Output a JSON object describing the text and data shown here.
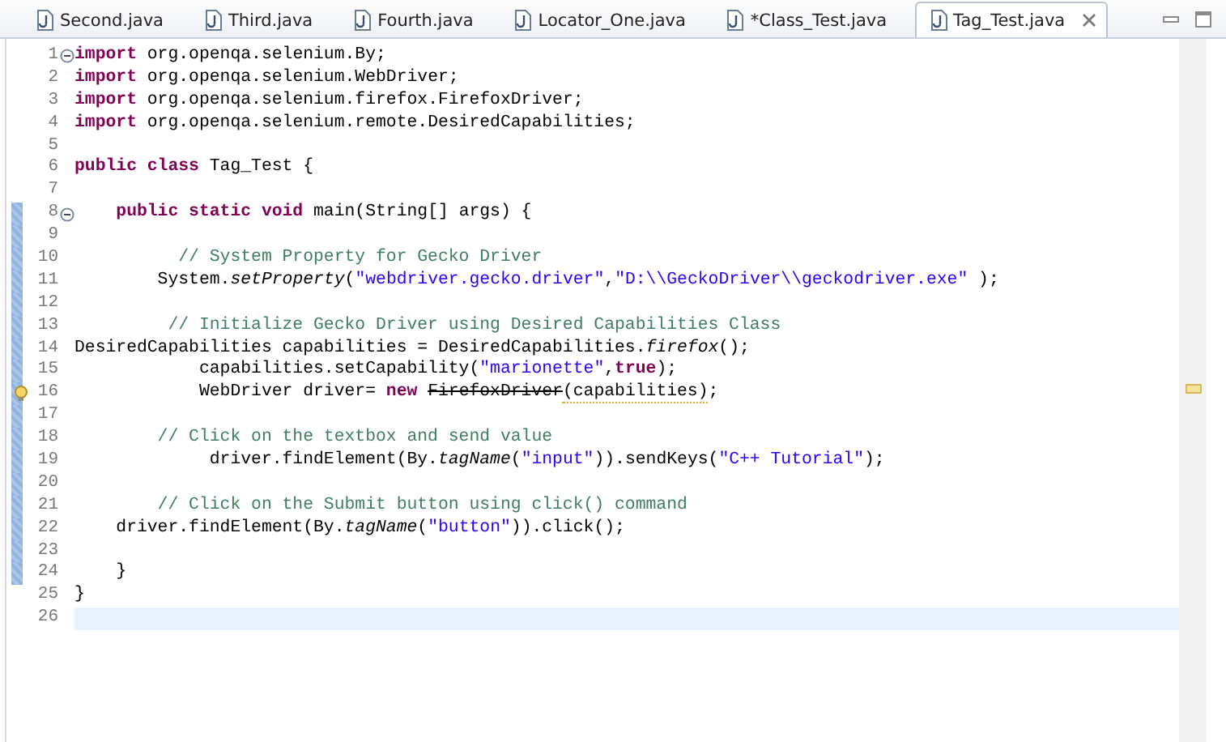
{
  "tabs": [
    {
      "label": "Second.java",
      "selected": false
    },
    {
      "label": "Third.java",
      "selected": false
    },
    {
      "label": "Fourth.java",
      "selected": false
    },
    {
      "label": "Locator_One.java",
      "selected": false
    },
    {
      "label": "*Class_Test.java",
      "selected": false
    },
    {
      "label": "Tag_Test.java",
      "selected": true
    }
  ],
  "editor": {
    "lines": [
      {
        "number": "1",
        "fold": true,
        "changed": false,
        "warning": false,
        "current": false,
        "tokens": [
          {
            "t": "import",
            "kind": "kw"
          },
          {
            "t": " org.openqa.selenium.By;",
            "kind": "plain"
          }
        ]
      },
      {
        "number": "2",
        "fold": false,
        "changed": false,
        "warning": false,
        "current": false,
        "tokens": [
          {
            "t": "import",
            "kind": "kw"
          },
          {
            "t": " org.openqa.selenium.WebDriver;",
            "kind": "plain"
          }
        ]
      },
      {
        "number": "3",
        "fold": false,
        "changed": false,
        "warning": false,
        "current": false,
        "tokens": [
          {
            "t": "import",
            "kind": "kw"
          },
          {
            "t": " org.openqa.selenium.firefox.FirefoxDriver;",
            "kind": "plain"
          }
        ]
      },
      {
        "number": "4",
        "fold": false,
        "changed": false,
        "warning": false,
        "current": false,
        "tokens": [
          {
            "t": "import",
            "kind": "kw"
          },
          {
            "t": " org.openqa.selenium.remote.DesiredCapabilities;",
            "kind": "plain"
          }
        ]
      },
      {
        "number": "5",
        "fold": false,
        "changed": false,
        "warning": false,
        "current": false
      },
      {
        "number": "6",
        "fold": false,
        "changed": false,
        "warning": false,
        "current": false,
        "tokens": [
          {
            "t": "public class",
            "kind": "kw"
          },
          {
            "t": " Tag_Test {",
            "kind": "plain"
          }
        ]
      },
      {
        "number": "7",
        "fold": false,
        "changed": false,
        "warning": false,
        "current": false
      },
      {
        "number": "8",
        "fold": true,
        "changed": true,
        "warning": false,
        "current": false,
        "tokens": [
          {
            "t": "    public static void",
            "kind": "kw"
          },
          {
            "t": " main(String[] args) {",
            "kind": "plain"
          }
        ]
      },
      {
        "number": "9",
        "fold": false,
        "changed": true,
        "warning": false,
        "current": false
      },
      {
        "number": "10",
        "fold": false,
        "changed": true,
        "warning": false,
        "current": false,
        "tokens": [
          {
            "t": "          // System Property for Gecko Driver",
            "kind": "comment"
          }
        ]
      },
      {
        "number": "11",
        "fold": false,
        "changed": true,
        "warning": false,
        "current": false,
        "tokens": [
          {
            "t": "        System.",
            "kind": "plain"
          },
          {
            "t": "setProperty",
            "kind": "italic"
          },
          {
            "t": "(",
            "kind": "plain"
          },
          {
            "t": "\"webdriver.gecko.driver\"",
            "kind": "str"
          },
          {
            "t": ",",
            "kind": "plain"
          },
          {
            "t": "\"D:\\\\GeckoDriver\\\\geckodriver.exe\"",
            "kind": "str"
          },
          {
            "t": " );",
            "kind": "plain"
          }
        ]
      },
      {
        "number": "12",
        "fold": false,
        "changed": true,
        "warning": false,
        "current": false
      },
      {
        "number": "13",
        "fold": false,
        "changed": true,
        "warning": false,
        "current": false,
        "tokens": [
          {
            "t": "         // Initialize Gecko Driver using Desired Capabilities Class",
            "kind": "comment"
          }
        ]
      },
      {
        "number": "14",
        "fold": false,
        "changed": true,
        "warning": false,
        "current": false,
        "tokens": [
          {
            "t": "DesiredCapabilities capabilities = DesiredCapabilities.",
            "kind": "plain"
          },
          {
            "t": "firefox",
            "kind": "italic"
          },
          {
            "t": "();",
            "kind": "plain"
          }
        ]
      },
      {
        "number": "15",
        "fold": false,
        "changed": true,
        "warning": false,
        "current": false,
        "tokens": [
          {
            "t": "            capabilities.setCapability(",
            "kind": "plain"
          },
          {
            "t": "\"marionette\"",
            "kind": "str"
          },
          {
            "t": ",",
            "kind": "plain"
          },
          {
            "t": "true",
            "kind": "kw"
          },
          {
            "t": ");",
            "kind": "plain"
          }
        ]
      },
      {
        "number": "16",
        "fold": false,
        "changed": true,
        "warning": true,
        "current": false,
        "tokens": [
          {
            "t": "            WebDriver driver= ",
            "kind": "plain"
          },
          {
            "t": "new ",
            "kind": "kw"
          },
          {
            "t": "FirefoxDriver",
            "kind": "deprecated"
          },
          {
            "t": "(capabilities)",
            "kind": "warned"
          },
          {
            "t": ";",
            "kind": "plain"
          }
        ]
      },
      {
        "number": "17",
        "fold": false,
        "changed": true,
        "warning": false,
        "current": false
      },
      {
        "number": "18",
        "fold": false,
        "changed": true,
        "warning": false,
        "current": false,
        "tokens": [
          {
            "t": "        // Click on the textbox and send value",
            "kind": "comment"
          }
        ]
      },
      {
        "number": "19",
        "fold": false,
        "changed": true,
        "warning": false,
        "current": false,
        "tokens": [
          {
            "t": "             driver.findElement(By.",
            "kind": "plain"
          },
          {
            "t": "tagName",
            "kind": "italic"
          },
          {
            "t": "(",
            "kind": "plain"
          },
          {
            "t": "\"input\"",
            "kind": "str"
          },
          {
            "t": ")).sendKeys(",
            "kind": "plain"
          },
          {
            "t": "\"C++ Tutorial\"",
            "kind": "str"
          },
          {
            "t": ");",
            "kind": "plain"
          }
        ]
      },
      {
        "number": "20",
        "fold": false,
        "changed": true,
        "warning": false,
        "current": false
      },
      {
        "number": "21",
        "fold": false,
        "changed": true,
        "warning": false,
        "current": false,
        "tokens": [
          {
            "t": "        // Click on the Submit button using click() command",
            "kind": "comment"
          }
        ]
      },
      {
        "number": "22",
        "fold": false,
        "changed": true,
        "warning": false,
        "current": false,
        "tokens": [
          {
            "t": "    driver.findElement(By.",
            "kind": "plain"
          },
          {
            "t": "tagName",
            "kind": "italic"
          },
          {
            "t": "(",
            "kind": "plain"
          },
          {
            "t": "\"button\"",
            "kind": "str"
          },
          {
            "t": ")).click();",
            "kind": "plain"
          }
        ]
      },
      {
        "number": "23",
        "fold": false,
        "changed": true,
        "warning": false,
        "current": false
      },
      {
        "number": "24",
        "fold": false,
        "changed": true,
        "warning": false,
        "current": false,
        "tokens": [
          {
            "t": "    }",
            "kind": "plain"
          }
        ]
      },
      {
        "number": "25",
        "fold": false,
        "changed": false,
        "warning": false,
        "current": false,
        "tokens": [
          {
            "t": "}",
            "kind": "plain"
          }
        ]
      },
      {
        "number": "26",
        "fold": false,
        "changed": false,
        "warning": false,
        "current": true
      }
    ]
  }
}
